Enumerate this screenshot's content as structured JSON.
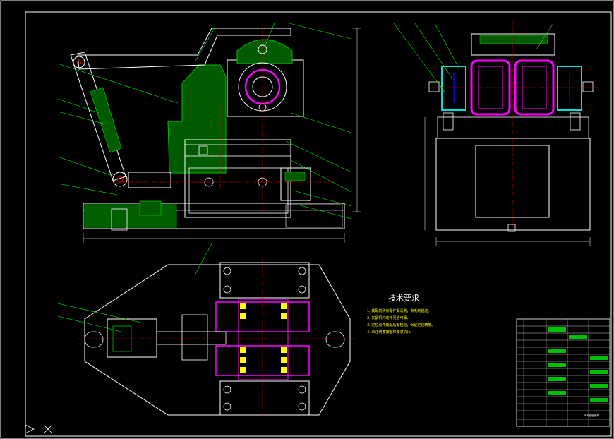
{
  "drawing": {
    "background": "#000000",
    "colors": {
      "outline": "#ffffff",
      "leader": "#00ff00",
      "hatch": "#00c000",
      "centerline": "#ff0000",
      "highlight": "#ff00ff",
      "bearing": "#00e0e0",
      "marker": "#ffff00",
      "detail": "#0000ff"
    },
    "tech_req_title": "技术要求",
    "tech_req_items": [
      "1. 装配前所有零件需清洗，去毛刺锐边。",
      "2. 夹紧机构动作灵活可靠。",
      "3. 定位元件装配后需检验，保证定位精度。",
      "4. 未注倒角按图样要求执行。"
    ],
    "title_block_name": "A3图纸名称"
  }
}
